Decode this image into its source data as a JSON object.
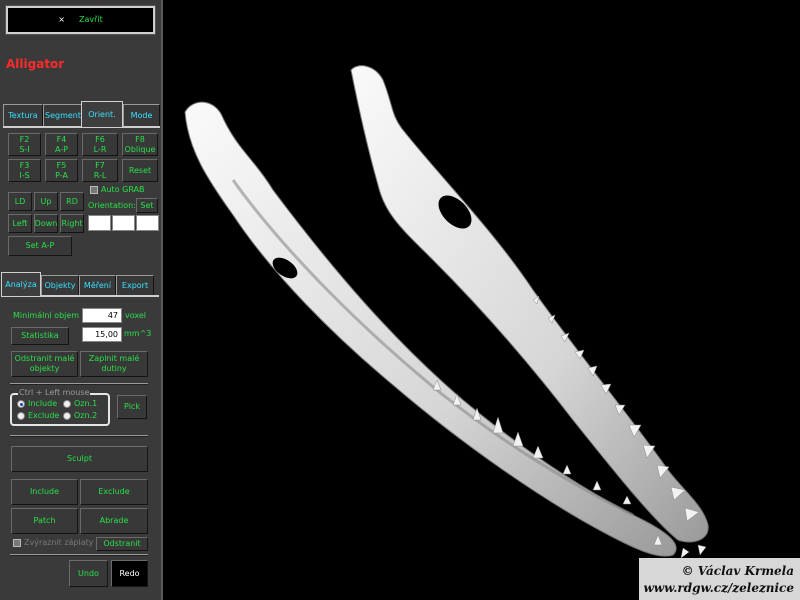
{
  "header": {
    "close_label": "Zavřít",
    "close_symbol": "×",
    "title": "Alligator",
    "title_color": "#ff2a2a"
  },
  "top_tabs": [
    {
      "label": "Textura",
      "active": false
    },
    {
      "label": "Segment",
      "active": false
    },
    {
      "label": "Orient.",
      "active": true
    },
    {
      "label": "Mode",
      "active": false
    }
  ],
  "orient": {
    "view_buttons": [
      {
        "key": "F2",
        "name": "S-I"
      },
      {
        "key": "F4",
        "name": "A-P"
      },
      {
        "key": "F6",
        "name": "L-R"
      },
      {
        "key": "F8",
        "name": "Oblique"
      },
      {
        "key": "F3",
        "name": "I-S"
      },
      {
        "key": "F5",
        "name": "P-A"
      },
      {
        "key": "F7",
        "name": "R-L"
      }
    ],
    "reset": "Reset",
    "dir": {
      "ld": "LD",
      "up": "Up",
      "rd": "RD",
      "left": "Left",
      "down": "Down",
      "right": "Right"
    },
    "auto_grab": "Auto GRAB",
    "orientation_label": "Orientation:",
    "set_label": "Set",
    "set_ap": "Set A-P"
  },
  "bottom_tabs": [
    {
      "label": "Analýza",
      "active": true
    },
    {
      "label": "Objekty",
      "active": false
    },
    {
      "label": "Měření",
      "active": false
    },
    {
      "label": "Export",
      "active": false
    }
  ],
  "analysis": {
    "min_volume_label": "Minimální objem",
    "min_volume_value": "47",
    "voxel_unit": "voxel",
    "stats_button": "Statistika",
    "mm3_value": "15,00",
    "mm3_unit": "mm^3",
    "remove_small": [
      "Odstranit malé",
      "objekty"
    ],
    "fill_small": [
      "Zaplnit malé",
      "dutiny"
    ],
    "group_title": "Ctrl + Left mouse",
    "include": "Include",
    "exclude": "Exclude",
    "ozn1": "Ozn.1",
    "ozn2": "Ozn.2",
    "pick": "Pick",
    "sculpt": "Sculpt",
    "include_btn": "Include",
    "exclude_btn": "Exclude",
    "patch": "Patch",
    "abrade": "Abrade",
    "highlight_patches": "Zvýraznit záplaty",
    "remove": "Odstranit",
    "undo": "Undo",
    "redo": "Redo"
  },
  "credit": {
    "line1": "© Václav Krmela",
    "line2": "www.rdgw.cz/zeleznice"
  }
}
